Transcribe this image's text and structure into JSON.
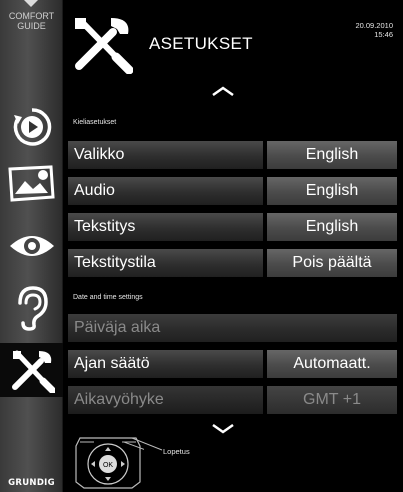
{
  "sidebar": {
    "comfort_line1": "COMFORT",
    "comfort_line2": "GUIDE",
    "items": [
      {
        "icon": "play-disc-icon"
      },
      {
        "icon": "picture-icon"
      },
      {
        "icon": "eye-icon"
      },
      {
        "icon": "ear-icon"
      },
      {
        "icon": "settings-tools-icon",
        "active": true
      }
    ],
    "brand": "GRUNDIG"
  },
  "header": {
    "title": "ASETUKSET",
    "date": "20.09.2010",
    "time": "15:46"
  },
  "sections": {
    "language": "Kieliasetukset",
    "datetime": "Date and time settings"
  },
  "rows": {
    "menu": {
      "label": "Valikko",
      "value": "English"
    },
    "audio": {
      "label": "Audio",
      "value": "English"
    },
    "subtitle": {
      "label": "Tekstitys",
      "value": "English"
    },
    "subtitle_mode": {
      "label": "Tekstitystila",
      "value": "Pois päältä"
    },
    "date_time": {
      "label": "Päiväja aika"
    },
    "time_adjust": {
      "label": "Ajan säätö",
      "value": "Automaatt."
    },
    "timezone": {
      "label": "Aikavyöhyke",
      "value": "GMT +1"
    }
  },
  "remote": {
    "ok_label": "OK",
    "exit_label": "Lopetus"
  },
  "colors": {
    "background": "#000000",
    "label_bg": "#2e2e2e",
    "value_bg": "#4b4b4b",
    "disabled_text": "#8a8a8a"
  }
}
